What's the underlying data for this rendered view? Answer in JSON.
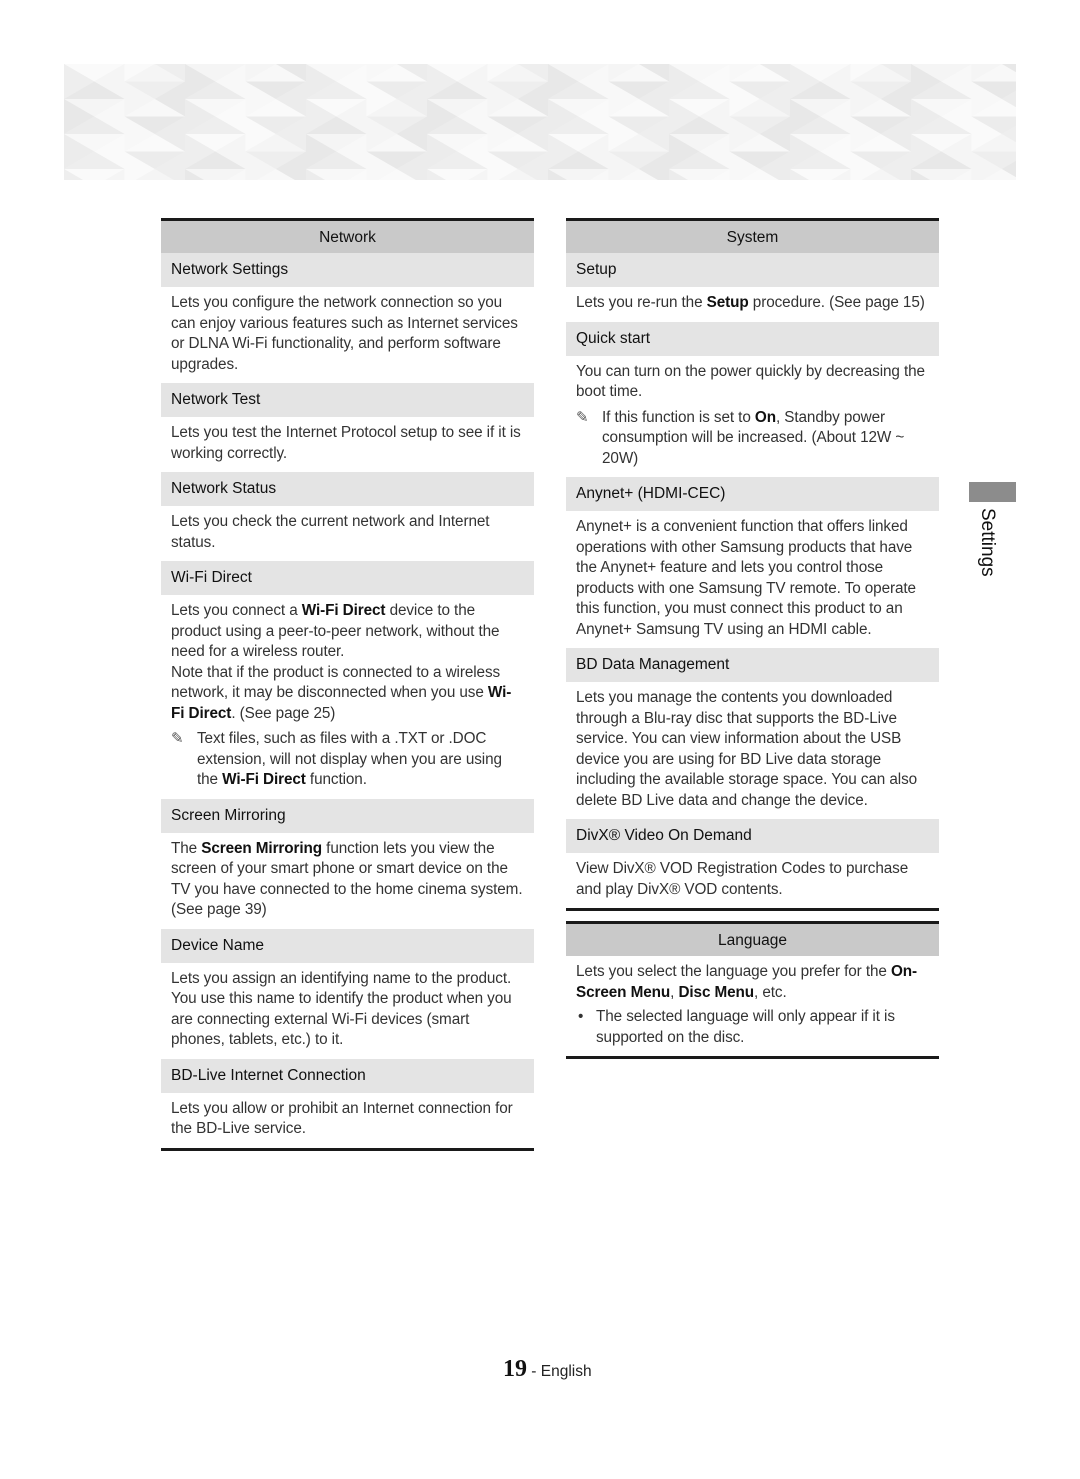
{
  "side_tab": {
    "label": "Settings",
    "color": "#8c8c8c"
  },
  "footer": {
    "page_number": "19",
    "separator": " - ",
    "language": "English"
  },
  "left_column": {
    "section_title": "Network",
    "items": [
      {
        "title": "Network Settings",
        "body": "Lets you configure the network connection so you can enjoy various features such as Internet services or DLNA Wi-Fi functionality, and perform software upgrades."
      },
      {
        "title": "Network Test",
        "body": "Lets you test the Internet Protocol setup to see if it is working correctly."
      },
      {
        "title": "Network Status",
        "body": "Lets you check the current network and Internet status."
      },
      {
        "title": "Wi-Fi Direct",
        "body_parts": [
          "Lets you connect a ",
          "Wi-Fi Direct",
          " device to the product using a peer-to-peer network, without the need for a wireless router."
        ],
        "body2_parts": [
          "Note that if the product is connected to a wireless network, it may be disconnected when you use ",
          "Wi-Fi Direct",
          ". (See page 25)"
        ],
        "note_icon": "note-pencil-icon",
        "note_parts": [
          "Text files, such as files with a .TXT or .DOC extension, will not display when you are using the ",
          "Wi-Fi Direct",
          " function."
        ]
      },
      {
        "title": "Screen Mirroring",
        "body_parts": [
          "The ",
          "Screen Mirroring",
          " function lets you view the screen of your smart phone or smart device on the TV you have connected to the home cinema system. (See page 39)"
        ]
      },
      {
        "title": "Device Name",
        "body": "Lets you assign an identifying name to the product. You use this name to identify the product when you are connecting external Wi-Fi devices (smart phones, tablets, etc.) to it."
      },
      {
        "title": "BD-Live Internet Connection",
        "body": "Lets you allow or prohibit an Internet connection for the BD-Live service."
      }
    ]
  },
  "right_column": {
    "section_title": "System",
    "items": [
      {
        "title": "Setup",
        "body_parts": [
          "Lets you re-run the ",
          "Setup",
          " procedure. (See page 15)"
        ]
      },
      {
        "title": "Quick start",
        "body": "You can turn on the power quickly by decreasing the boot time.",
        "note_icon": "note-pencil-icon",
        "note_parts": [
          "If this function is set to ",
          "On",
          ", Standby power consumption will be increased. (About 12W ~ 20W)"
        ]
      },
      {
        "title": "Anynet+ (HDMI-CEC)",
        "body": "Anynet+ is a convenient function that offers linked operations with other Samsung products that have the Anynet+ feature and lets you control those products with one Samsung TV remote. To operate this function, you must connect this product to an Anynet+ Samsung TV using an HDMI cable."
      },
      {
        "title": "BD Data Management",
        "body": "Lets you manage the contents you downloaded through a Blu-ray disc that supports the BD-Live service. You can view information about the USB device you are using for BD Live data storage including the available storage space. You can also delete BD Live data and change the device."
      },
      {
        "title": "DivX® Video On Demand",
        "body": "View DivX® VOD Registration Codes to purchase and play DivX® VOD contents."
      }
    ],
    "language_section": {
      "section_title": "Language",
      "body_parts": [
        "Lets you select the language you prefer for the ",
        "On-Screen Menu",
        ", ",
        "Disc Menu",
        ", etc."
      ],
      "bullet_symbol": "•",
      "bullet": "The selected language will only appear if it is supported on the disc."
    }
  },
  "icons": {
    "note": "✎"
  }
}
